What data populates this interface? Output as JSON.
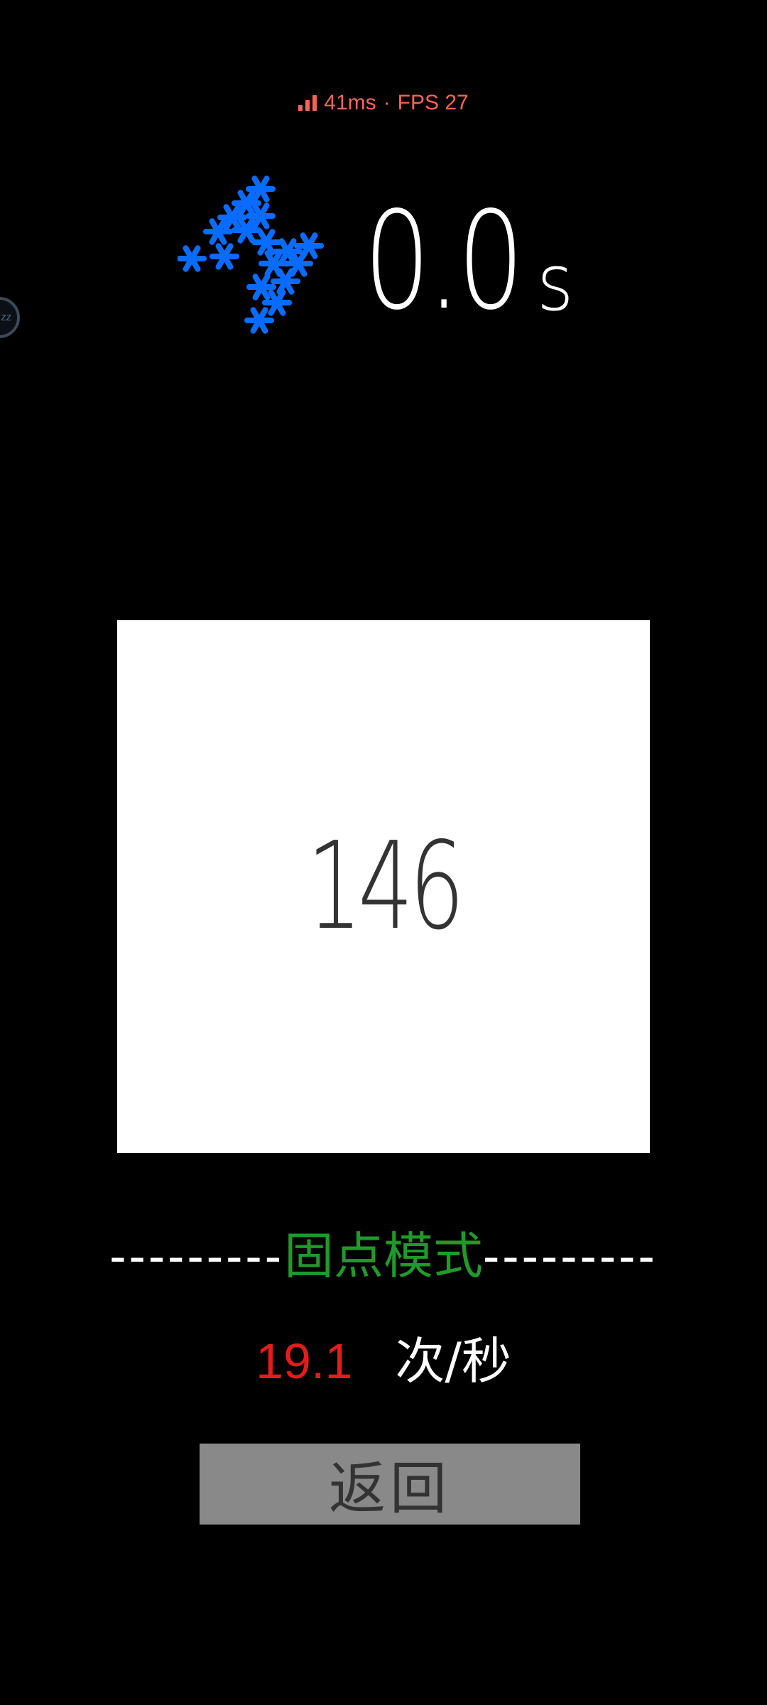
{
  "status": {
    "latency": "41ms",
    "separator": "·",
    "fps": "FPS 27"
  },
  "floating_ball": {
    "label": "zz"
  },
  "timer": {
    "value": "0.0",
    "unit": "s"
  },
  "board": {
    "count": "146"
  },
  "mode": {
    "dashes_left": "---------",
    "label": "固点模式",
    "dashes_right": "---------"
  },
  "rate": {
    "value": "19.1",
    "unit": "次/秒"
  },
  "back_button": {
    "label": "返回"
  },
  "colors": {
    "background": "#000000",
    "status": "#f2665a",
    "logo": "#0a6cff",
    "mode": "#1f9a2b",
    "rate": "#e31c1c",
    "button": "#898989"
  },
  "icons": {
    "status": "signal-bars-icon",
    "logo": "asterisk-cluster-logo"
  }
}
